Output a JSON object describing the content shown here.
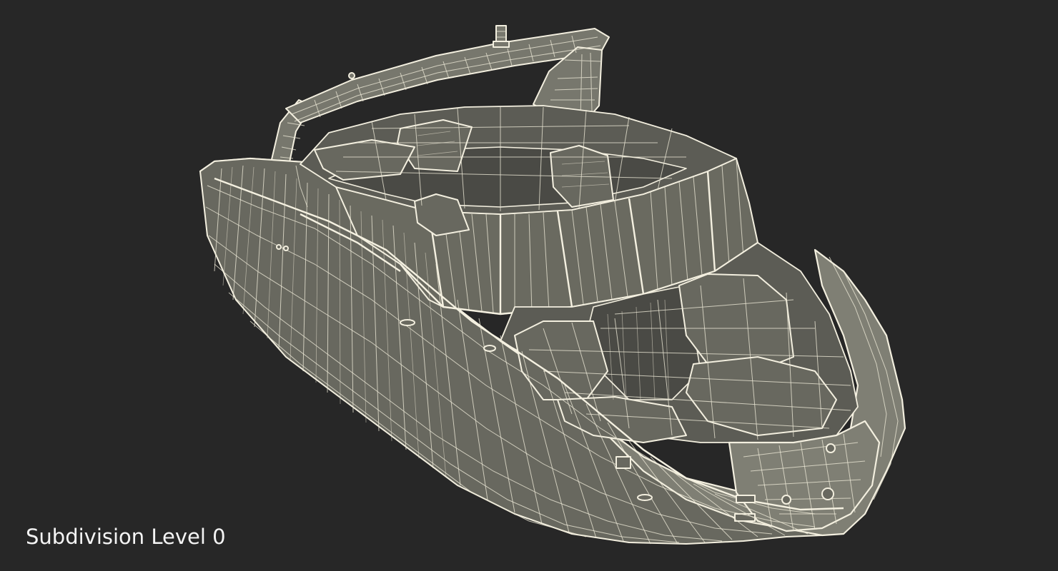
{
  "caption": "Subdivision Level 0",
  "colors": {
    "background": "#272727",
    "hull": "#7f7f74",
    "wireframe": "#f3efdf",
    "caption_text": "#f4f4f4"
  }
}
